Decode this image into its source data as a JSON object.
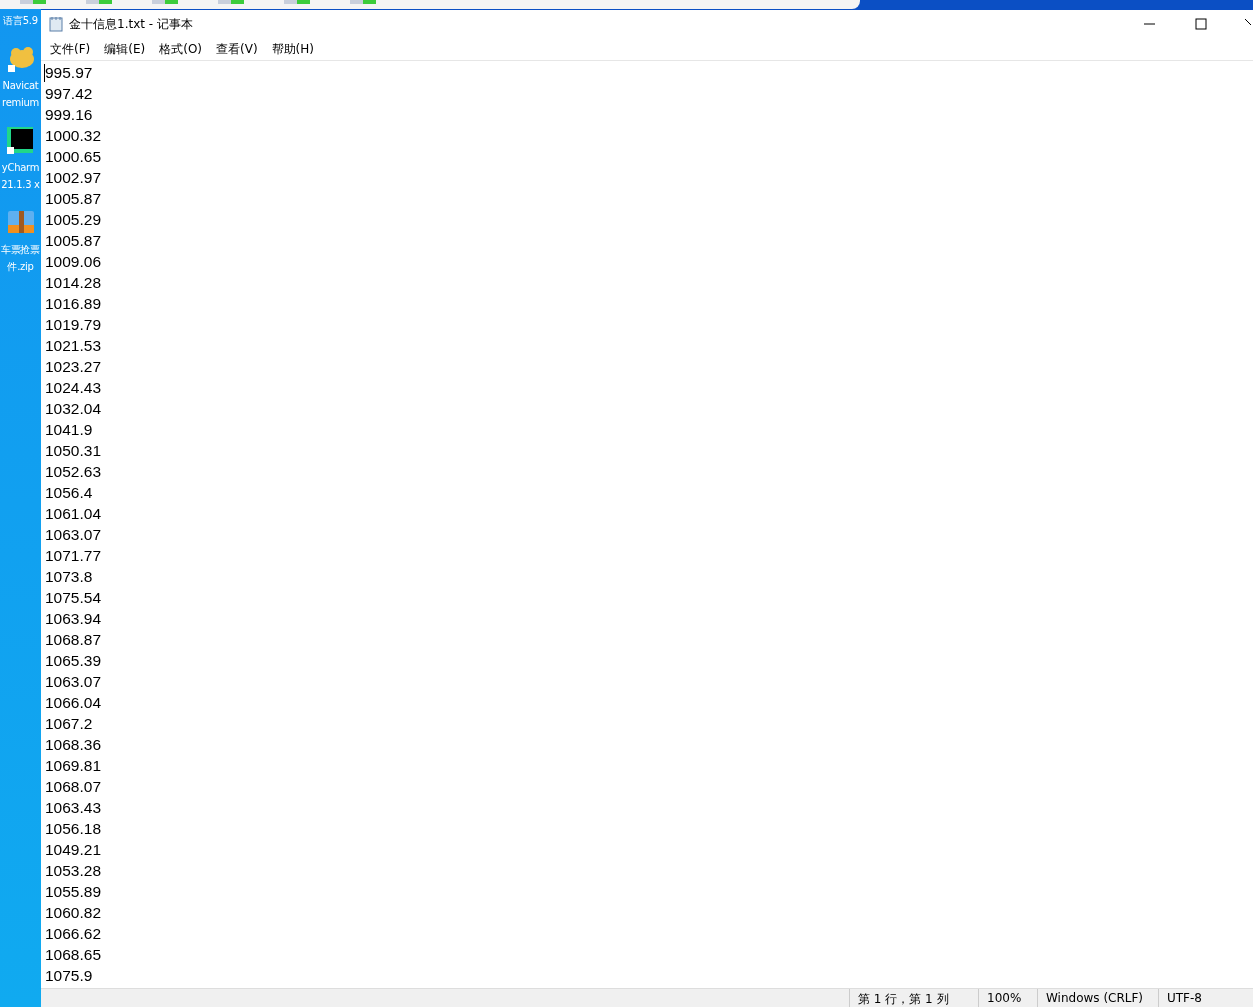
{
  "desktop": {
    "top_label": "语言5.9",
    "icons": [
      {
        "kind": "navicat",
        "lines": [
          "Navicat",
          "remium"
        ]
      },
      {
        "kind": "pycharm",
        "lines": [
          "yCharm",
          "21.1.3 x"
        ]
      },
      {
        "kind": "zip",
        "lines": [
          "车票抢票",
          "件.zip"
        ]
      }
    ]
  },
  "window": {
    "title": "金十信息1.txt - 记事本"
  },
  "menu": [
    "文件(F)",
    "编辑(E)",
    "格式(O)",
    "查看(V)",
    "帮助(H)"
  ],
  "editor": {
    "lines": [
      "995.97",
      "997.42",
      "999.16",
      "1000.32",
      "1000.65",
      "1002.97",
      "1005.87",
      "1005.29",
      "1005.87",
      "1009.06",
      "1014.28",
      "1016.89",
      "1019.79",
      "1021.53",
      "1023.27",
      "1024.43",
      "1032.04",
      "1041.9",
      "1050.31",
      "1052.63",
      "1056.4",
      "1061.04",
      "1063.07",
      "1071.77",
      "1073.8",
      "1075.54",
      "1063.94",
      "1068.87",
      "1065.39",
      "1063.07",
      "1066.04",
      "1067.2",
      "1068.36",
      "1069.81",
      "1068.07",
      "1063.43",
      "1056.18",
      "1049.21",
      "1053.28",
      "1055.89",
      "1060.82",
      "1066.62",
      "1068.65",
      "1075.9"
    ]
  },
  "status_bar": [
    "第 1 行，第 1 列",
    "100%",
    "Windows (CRLF)",
    "UTF-8"
  ]
}
